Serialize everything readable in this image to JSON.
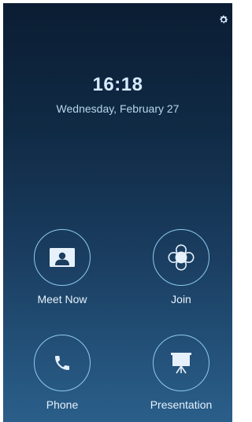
{
  "status": {
    "time": "16:18",
    "date": "Wednesday, February 27"
  },
  "actions": {
    "meet_now": {
      "label": "Meet Now",
      "icon": "contact-card-icon"
    },
    "join": {
      "label": "Join",
      "icon": "join-flower-icon"
    },
    "phone": {
      "label": "Phone",
      "icon": "phone-handset-icon"
    },
    "presentation": {
      "label": "Presentation",
      "icon": "projector-screen-icon"
    }
  },
  "toolbar": {
    "settings_icon": "gear-icon"
  },
  "colors": {
    "background_top": "#0b1d33",
    "background_bottom": "#2a5f8a",
    "accent_ring": "#8ecaf0",
    "text": "#e6f1fb"
  }
}
